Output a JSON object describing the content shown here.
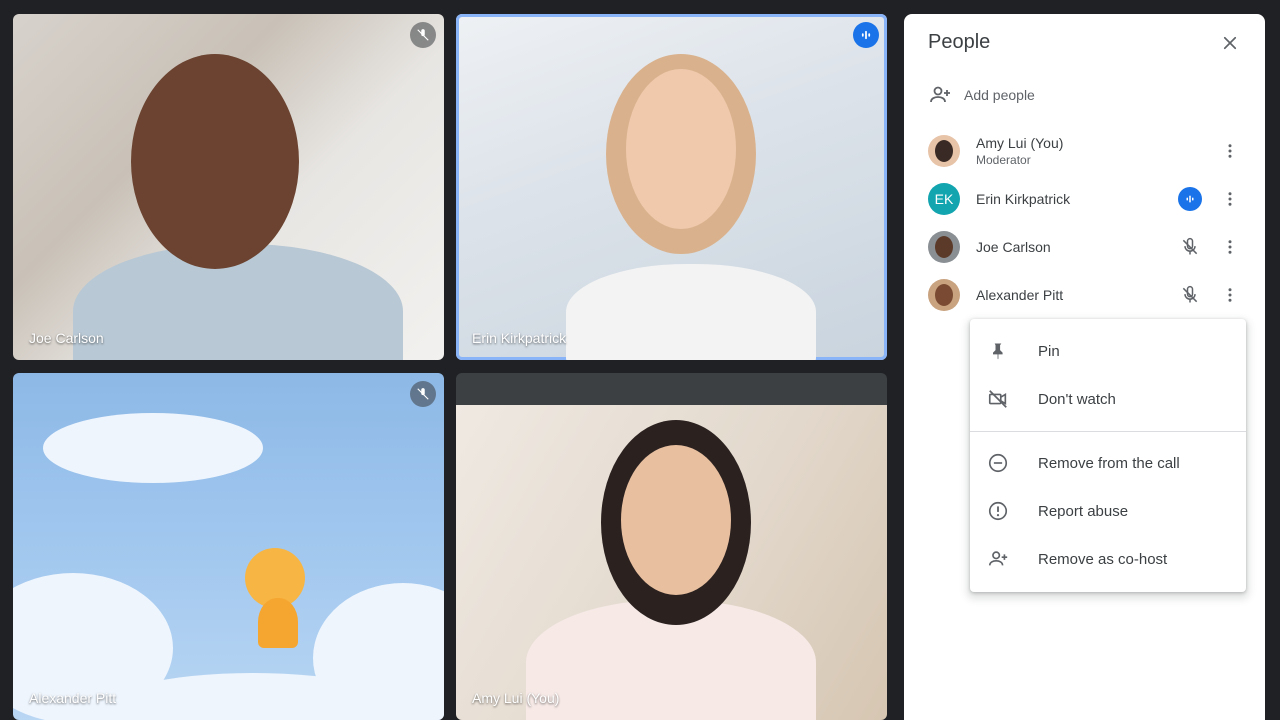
{
  "tiles": {
    "joe": {
      "name": "Joe Carlson",
      "muted": true
    },
    "erin": {
      "name": "Erin Kirkpatrick",
      "speaking": true
    },
    "alex": {
      "name": "Alexander Pitt",
      "muted": true
    },
    "amy": {
      "name": "Amy Lui (You)"
    }
  },
  "panel": {
    "title": "People",
    "add_people_label": "Add people",
    "participants": [
      {
        "name": "Amy Lui (You)",
        "role": "Moderator",
        "avatar": "photo",
        "status": "none"
      },
      {
        "name": "Erin Kirkpatrick",
        "role": "",
        "avatar_initials": "EK",
        "avatar_color": "#12a4af",
        "status": "speaking"
      },
      {
        "name": "Joe Carlson",
        "role": "",
        "avatar": "photo",
        "status": "muted"
      },
      {
        "name": "Alexander Pitt",
        "role": "",
        "avatar": "photo",
        "status": "muted"
      }
    ]
  },
  "menu": {
    "items": [
      {
        "label": "Pin",
        "icon": "pin-icon"
      },
      {
        "label": "Don't watch",
        "icon": "video-off-icon"
      },
      {
        "label": "Remove from the call",
        "icon": "remove-circle-icon"
      },
      {
        "label": "Report abuse",
        "icon": "report-icon"
      },
      {
        "label": "Remove as co-host",
        "icon": "person-add-icon"
      }
    ]
  },
  "colors": {
    "background": "#202124",
    "accent": "#1a73e8",
    "active_border": "#8ab4f8"
  }
}
